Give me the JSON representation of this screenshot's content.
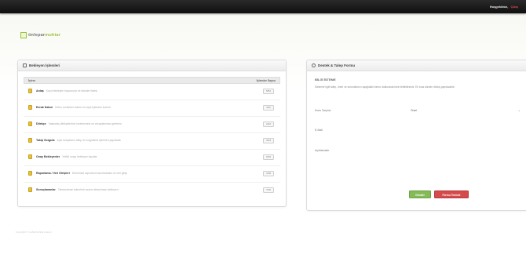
{
  "topbar": {
    "username": "Hoşgeldiniz,",
    "logout": "Çıkış"
  },
  "logo": {
    "part1": "önlepar",
    "part2": "muhtar"
  },
  "left_panel": {
    "title": "Bekleyen İşlemleri",
    "columns": [
      "İşlem",
      "İşlemler Sayısı"
    ],
    "rows": [
      {
        "name": "Anlaş",
        "desc": "Kayıt bekleyen başvurular ve talepler listesi",
        "count": "5/51"
      },
      {
        "name": "Evrak Kabul",
        "desc": "Gelen evrakların kabul ve kayıt işlemleri kontrol",
        "count": "4/11"
      },
      {
        "name": "Dilekçe",
        "desc": "Vatandaş dilekçelerinin incelenmesi ve cevaplanması gereken",
        "count": "2/12"
      },
      {
        "name": "Takip Sorgula",
        "desc": "Açık dosyaların takip ve sorgulama işlemleri yapılacak",
        "count": "3/24"
      },
      {
        "name": "Onay Bekleyenler",
        "desc": "Yetkili onayı bekleyen kayıtlar",
        "count": "6/15"
      },
      {
        "name": "Raporlama / Veri Girişleri",
        "desc": "Dönemsel raporların hazırlanması ve veri girişi",
        "count": "1/10"
      },
      {
        "name": "Sonuçlananlar",
        "desc": "Tamamlanan işlemlerin arşive aktarılması bekleyen",
        "count": "7/20"
      }
    ]
  },
  "right_panel": {
    "title": "Destek & Talep Formu",
    "form_title": "BİLGİ İSTEME",
    "form_desc": "Sistemle ilgili talep, öneri ve sorunlarınızı aşağıdaki formu doldurarak bize iletebilirsiniz. En kısa sürede dönüş yapılacaktır.",
    "fields": [
      {
        "label": "Konu Seçiniz",
        "value": "Öneri"
      },
      {
        "label": "E-Mail",
        "value": ""
      },
      {
        "label": "Açıklamalar",
        "value": ""
      }
    ],
    "save_label": "Gönder",
    "cancel_label": "Formu Temizle"
  },
  "footer": {
    "text": "Copyright © muhtarlık bilgi sistemi"
  }
}
